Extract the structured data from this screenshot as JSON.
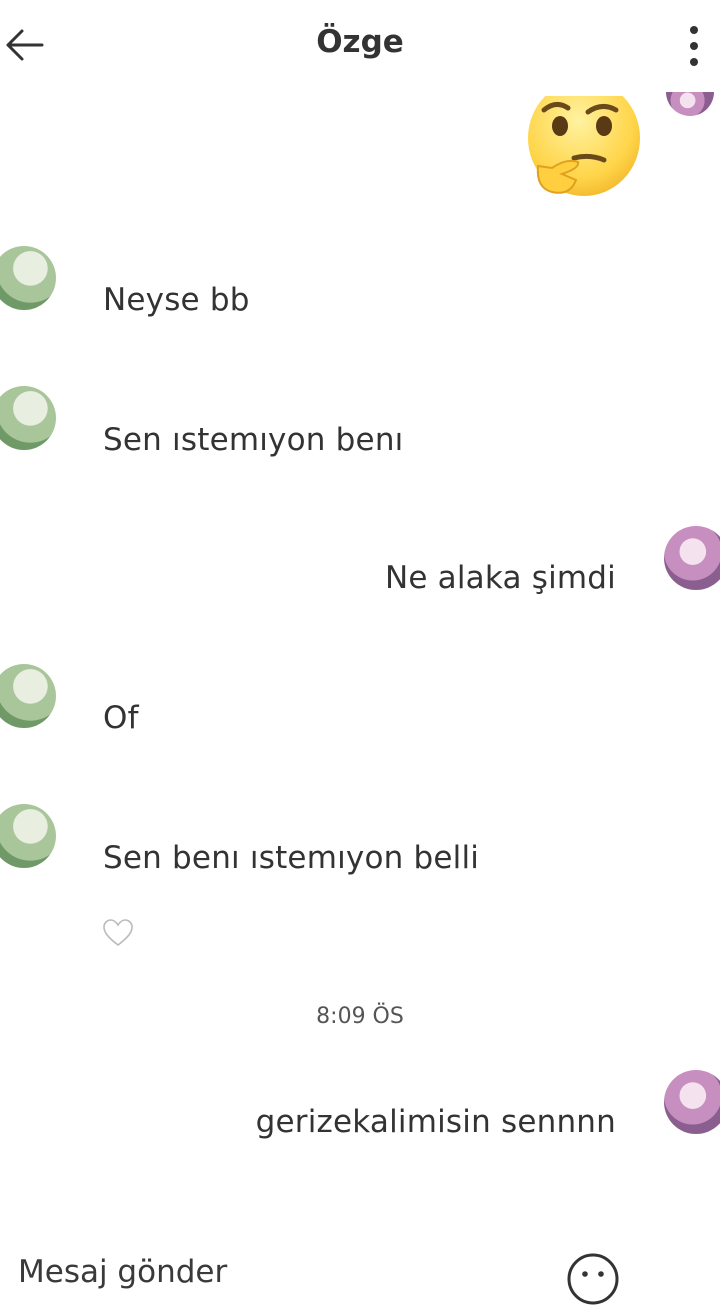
{
  "header": {
    "title": "Özge",
    "back_icon": "arrow-left-icon",
    "more_icon": "more-vertical-icon"
  },
  "messages": [
    {
      "side": "right",
      "type": "emoji",
      "emoji": "thinking-face-emoji"
    },
    {
      "side": "left",
      "text": "Neyse bb"
    },
    {
      "side": "left",
      "text": "Sen ıstemıyon benı"
    },
    {
      "side": "right",
      "text": "Ne alaka şimdi"
    },
    {
      "side": "left",
      "text": "Of"
    },
    {
      "side": "left",
      "text": "Sen benı ıstemıyon belli"
    },
    {
      "side": "right",
      "text": "gerizekalimisin sennnn"
    }
  ],
  "like_icon": "heart-outline-icon",
  "timestamp": "8:09 ÖS",
  "composer": {
    "placeholder": "Mesaj gönder",
    "emoji_icon": "smiley-icon"
  },
  "colors": {
    "text": "#333333",
    "background": "#ffffff"
  }
}
